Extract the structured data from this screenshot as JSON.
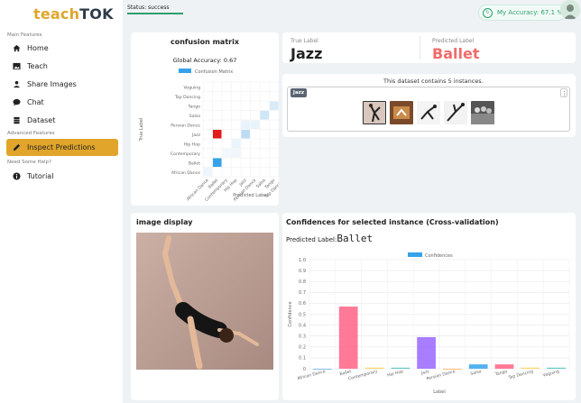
{
  "app": {
    "logo_a": "teach",
    "logo_b": "TOK"
  },
  "sidebar": {
    "main_label": "Main Features",
    "advanced_label": "Advanced Features",
    "help_label": "Need Some Help?",
    "items": [
      {
        "label": "Home",
        "icon": "home-icon"
      },
      {
        "label": "Teach",
        "icon": "image-icon"
      },
      {
        "label": "Share Images",
        "icon": "user-upload-icon"
      },
      {
        "label": "Chat",
        "icon": "chat-icon"
      },
      {
        "label": "Dataset",
        "icon": "database-icon"
      },
      {
        "label": "Inspect Predictions",
        "icon": "pencil-icon"
      },
      {
        "label": "Tutorial",
        "icon": "info-icon"
      }
    ],
    "active_color": "#e0a52a"
  },
  "topbar": {
    "status": "Status: success",
    "accuracy": "My Accuracy: 67.1 %"
  },
  "confusion": {
    "title": "confusion matrix",
    "global_acc": "Global Accuracy: 0.67",
    "legend": "Confusion Matrix",
    "ylabel": "True Label",
    "xlabel": "Predicted Label",
    "labels": [
      "African Dance",
      "Ballet",
      "Contemporary",
      "Hip Hop",
      "Jazz",
      "Persian Dance",
      "Salsa",
      "Tango",
      "Tap Dancing",
      "Voguing"
    ]
  },
  "labels_panel": {
    "true_title": "True Label",
    "true_value": "Jazz",
    "pred_title": "Predicted Label",
    "pred_value": "Ballet"
  },
  "dataset_panel": {
    "text": "This dataset contains 5 instances.",
    "tag": "Jazz",
    "more": "⋮"
  },
  "image_display": {
    "title": "image display"
  },
  "confidences": {
    "title": "Confidences for selected instance (Cross-validation)",
    "pred_prefix": "Predicted Label:",
    "pred_value": "Ballet"
  },
  "chart_data": {
    "type": "bar",
    "title": "",
    "legend": "Confidences",
    "xlabel": "Label",
    "ylabel": "Confidence",
    "ylim": [
      0,
      1.0
    ],
    "yticks": [
      "0",
      "0.1",
      "0.2",
      "0.3",
      "0.4",
      "0.5",
      "0.6",
      "0.7",
      "0.8",
      "0.9",
      "1.0"
    ],
    "categories": [
      "African Dance",
      "Ballet",
      "Contemporary",
      "Hip Hop",
      "Jazz",
      "Persian Dance",
      "Salsa",
      "Tango",
      "Tap Dancing",
      "Voguing"
    ],
    "values": [
      0.0,
      0.57,
      0.01,
      0.01,
      0.29,
      0.0,
      0.04,
      0.04,
      0.01,
      0.01
    ],
    "colors": [
      "#4aa3e8",
      "#ff6384",
      "#ffcd56",
      "#4bc0c0",
      "#9966ff",
      "#ff9f40",
      "#36a2eb",
      "#ff6384",
      "#ffcd56",
      "#4bc0c0"
    ],
    "legend_color": "#36a2eb",
    "grid": true
  }
}
